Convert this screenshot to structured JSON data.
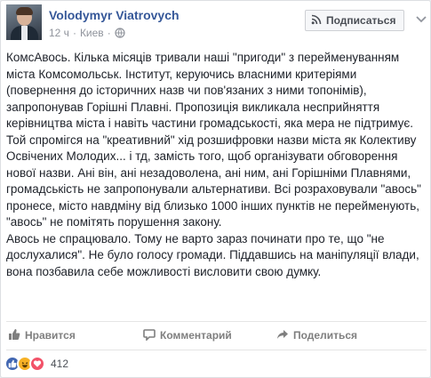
{
  "post": {
    "author": "Volodymyr Viatrovych",
    "time": "12 ч",
    "location": "Киев",
    "subscribe_label": "Подписаться",
    "paragraphs": [
      "КомсАвось. Кілька місяців тривали наші \"пригоди\" з перейменуванням міста Комсомольськ. Інститут, керуючись власними критеріями (повернення до історичних назв чи пов'язаних з ними топонімів), запропонував Горішні Плавні. Пропозиція викликала несприйняття керівництва міста і навіть частини громадськості, яка мера не підтримує. Той спромігся на \"креативний\" хід розшифровки назви міста як Колективу Освічених Молодих... і тд, замість того, щоб організувати обговорення нової назви. Ані він, ані незадоволена, ані ним, ані Горішніми Плавнями, громадськість не запропонували альтернативи. Всі розраховували \"авось\" пронесе, місто навдміну від близько 1000 інших пунктів не перейменують, \"авось\" не помітять порушення закону.",
      "Авось не спрацювало. Тому не варто зараз починати про те, що \"не дослухалися\". Не було голосу громади. Піддавшись на маніпуляції влади, вона позбавила себе можливості висловити свою думку."
    ]
  },
  "actions": {
    "like_label": "Нравится",
    "comment_label": "Комментарий",
    "share_label": "Поделиться"
  },
  "reactions": {
    "count": "412",
    "types": [
      "like-icon",
      "haha-icon",
      "love-icon"
    ]
  },
  "colors": {
    "link": "#365899",
    "meta": "#90949c",
    "action": "#7f7f7f",
    "like_blue": "#4267b2",
    "haha_yellow": "#f7b125",
    "love_red": "#f25268"
  }
}
